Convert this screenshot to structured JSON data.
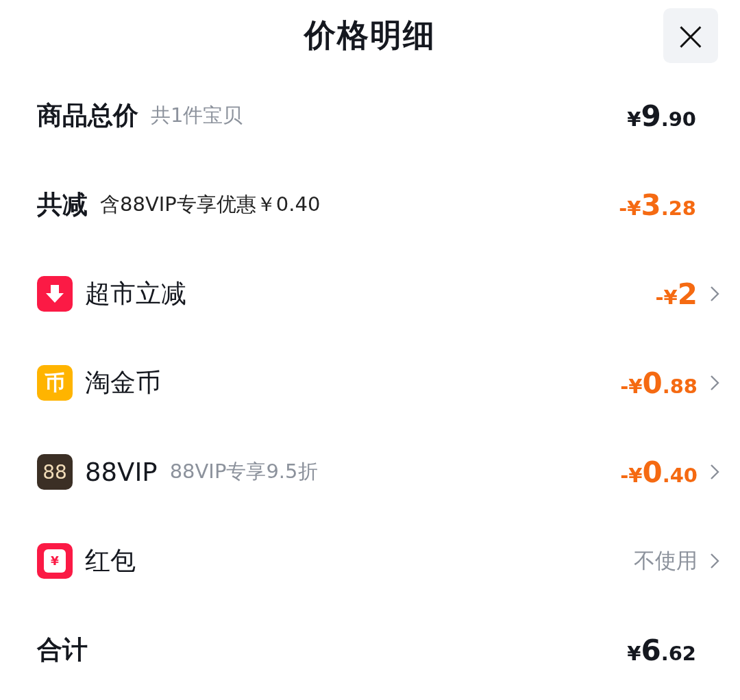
{
  "title": "价格明细",
  "close": {
    "label": "×"
  },
  "summary": {
    "label": "商品总价",
    "note": "共1件宝贝",
    "price": {
      "currency": "¥",
      "integer": "9",
      "decimal": ".90"
    }
  },
  "reduction": {
    "label": "共减",
    "note": "含88VIP专享优惠￥0.40",
    "price": {
      "sign": "-",
      "currency": "¥",
      "integer": "3",
      "decimal": ".28"
    }
  },
  "items": [
    {
      "kind": "arrow",
      "label": "超市立减",
      "price": {
        "sign": "-",
        "currency": "¥",
        "integer": "2"
      }
    },
    {
      "kind": "coin",
      "icon_text": "币",
      "label": "淘金币",
      "price": {
        "sign": "-",
        "currency": "¥",
        "integer": "0",
        "decimal": ".88"
      }
    },
    {
      "kind": "vip",
      "icon_text": "88",
      "label": "88VIP",
      "note": "88VIP专享9.5折",
      "price": {
        "sign": "-",
        "currency": "¥",
        "integer": "0",
        "decimal": ".40"
      }
    },
    {
      "kind": "packet",
      "icon_text": "¥",
      "label": "红包",
      "value": "不使用"
    }
  ],
  "total": {
    "label": "合计",
    "price": {
      "currency": "¥",
      "integer": "6",
      "decimal": ".62"
    }
  }
}
